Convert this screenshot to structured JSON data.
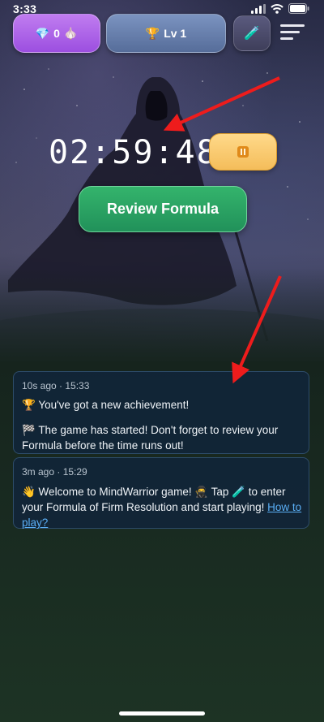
{
  "status_bar": {
    "time": "3:33"
  },
  "toolbar": {
    "gems_label": "0",
    "level_label": "Lv 1",
    "gem_icon": "gem-icon",
    "garlic_icon": "garlic-icon",
    "trophy_icon": "trophy-icon",
    "formula_icon": "test-tube-icon",
    "menu_icon": "menu-icon"
  },
  "timer": {
    "value": "02:59:48"
  },
  "actions": {
    "review_label": "Review Formula"
  },
  "notifications": [
    {
      "meta": "10s ago · 15:33",
      "line1": "🏆 You've got a new achievement!",
      "line2": "🏁 The game has started! Don't forget to review your Formula before the time runs out!"
    },
    {
      "meta": "3m ago · 15:29",
      "line1": "👋 Welcome to MindWarrior game! 🥷 Tap 🧪 to enter your Formula of Firm Resolution and start playing! ",
      "link": "How to play?"
    }
  ],
  "colors": {
    "gem_button": "#9c4fe0",
    "level_button": "#566d9a",
    "review_button": "#21915a",
    "pause_button": "#f4bd5a",
    "card_bg": "#112538",
    "link": "#5aaef5",
    "annotation_arrow": "#ee1c1c"
  }
}
